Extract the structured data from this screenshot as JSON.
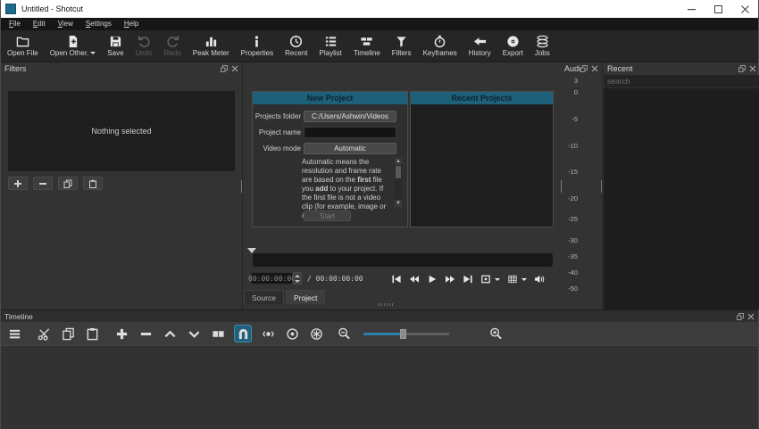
{
  "window": {
    "title": "Untitled - Shotcut"
  },
  "colors": {
    "accent_teal": "#1e6079",
    "titlebar_bg": "#ffffff",
    "toolbar_bg": "#262626"
  },
  "menu": {
    "items": [
      "File",
      "Edit",
      "View",
      "Settings",
      "Help"
    ]
  },
  "toolbar": {
    "buttons": [
      {
        "label": "Open File",
        "icon": "open-file-icon",
        "enabled": true
      },
      {
        "label": "Open Other.",
        "icon": "open-other-icon",
        "enabled": true,
        "dropdown": true
      },
      {
        "label": "Save",
        "icon": "save-icon",
        "enabled": true
      },
      {
        "label": "Undo",
        "icon": "undo-icon",
        "enabled": false
      },
      {
        "label": "Redo",
        "icon": "redo-icon",
        "enabled": false
      },
      {
        "label": "Peak Meter",
        "icon": "peak-meter-icon",
        "enabled": true
      },
      {
        "label": "Properties",
        "icon": "info-icon",
        "enabled": true
      },
      {
        "label": "Recent",
        "icon": "clock-icon",
        "enabled": true
      },
      {
        "label": "Playlist",
        "icon": "list-icon",
        "enabled": true
      },
      {
        "label": "Timeline",
        "icon": "timeline-icon",
        "enabled": true
      },
      {
        "label": "Filters",
        "icon": "funnel-icon",
        "enabled": true
      },
      {
        "label": "Keyframes",
        "icon": "stopwatch-icon",
        "enabled": true
      },
      {
        "label": "History",
        "icon": "history-icon",
        "enabled": true
      },
      {
        "label": "Export",
        "icon": "disc-icon",
        "enabled": true
      },
      {
        "label": "Jobs",
        "icon": "stack-icon",
        "enabled": true
      }
    ]
  },
  "panels": {
    "filters": {
      "title": "Filters",
      "empty_text": "Nothing selected"
    },
    "new_project": {
      "title": "New Project",
      "fields": [
        {
          "label": "Projects folder",
          "value": "C:/Users/Ashwin/Videos",
          "type": "button"
        },
        {
          "label": "Project name",
          "value": "",
          "type": "input"
        },
        {
          "label": "Video mode",
          "value": "Automatic",
          "type": "button"
        }
      ],
      "description_segments": [
        {
          "t": "Automatic means the resolution and frame rate are based on the ",
          "b": false
        },
        {
          "t": "first",
          "b": true
        },
        {
          "t": " file you ",
          "b": false
        },
        {
          "t": "add",
          "b": true
        },
        {
          "t": " to your project. If the first file is not a video clip (for example, image or audio),",
          "b": false
        }
      ],
      "start_label": "Start"
    },
    "recent_projects": {
      "title": "Recent Projects"
    },
    "audio_meter": {
      "title": "Audi...",
      "scale": [
        "3",
        "0",
        "-5",
        "-10",
        "-15",
        "-20",
        "-25",
        "-30",
        "-35",
        "-40",
        "-50"
      ]
    },
    "recent": {
      "title": "Recent",
      "search_placeholder": "search"
    },
    "timeline": {
      "title": "Timeline"
    }
  },
  "player": {
    "position": "00:00:00:00",
    "duration": "/ 00:00:00:00",
    "tabs": [
      {
        "label": "Source",
        "active": false
      },
      {
        "label": "Project",
        "active": true
      }
    ]
  }
}
